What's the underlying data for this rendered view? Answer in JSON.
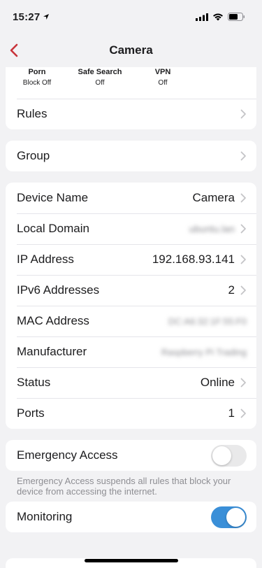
{
  "status_bar": {
    "time": "15:27"
  },
  "nav": {
    "title": "Camera"
  },
  "filters": [
    {
      "label": "Porn",
      "value": "Block Off"
    },
    {
      "label": "Safe Search",
      "value": "Off"
    },
    {
      "label": "VPN",
      "value": "Off"
    }
  ],
  "rows": {
    "rules": {
      "label": "Rules"
    },
    "group": {
      "label": "Group"
    },
    "device_name": {
      "label": "Device Name",
      "value": "Camera"
    },
    "local_domain": {
      "label": "Local Domain",
      "value": "ubuntu.lan"
    },
    "ip_address": {
      "label": "IP Address",
      "value": "192.168.93.141"
    },
    "ipv6_addresses": {
      "label": "IPv6 Addresses",
      "value": "2"
    },
    "mac_address": {
      "label": "MAC Address",
      "value": "DC:A6:32:1F:55:F0"
    },
    "manufacturer": {
      "label": "Manufacturer",
      "value": "Raspberry Pi Trading"
    },
    "status": {
      "label": "Status",
      "value": "Online"
    },
    "ports": {
      "label": "Ports",
      "value": "1"
    }
  },
  "emergency_access": {
    "label": "Emergency Access",
    "enabled": false,
    "note": "Emergency Access suspends all rules that block your device from accessing the internet."
  },
  "monitoring": {
    "label": "Monitoring",
    "enabled": true
  },
  "colors": {
    "accent": "#c8333a",
    "toggle_on": "#3a8fd8",
    "background": "#f2f2f4"
  }
}
